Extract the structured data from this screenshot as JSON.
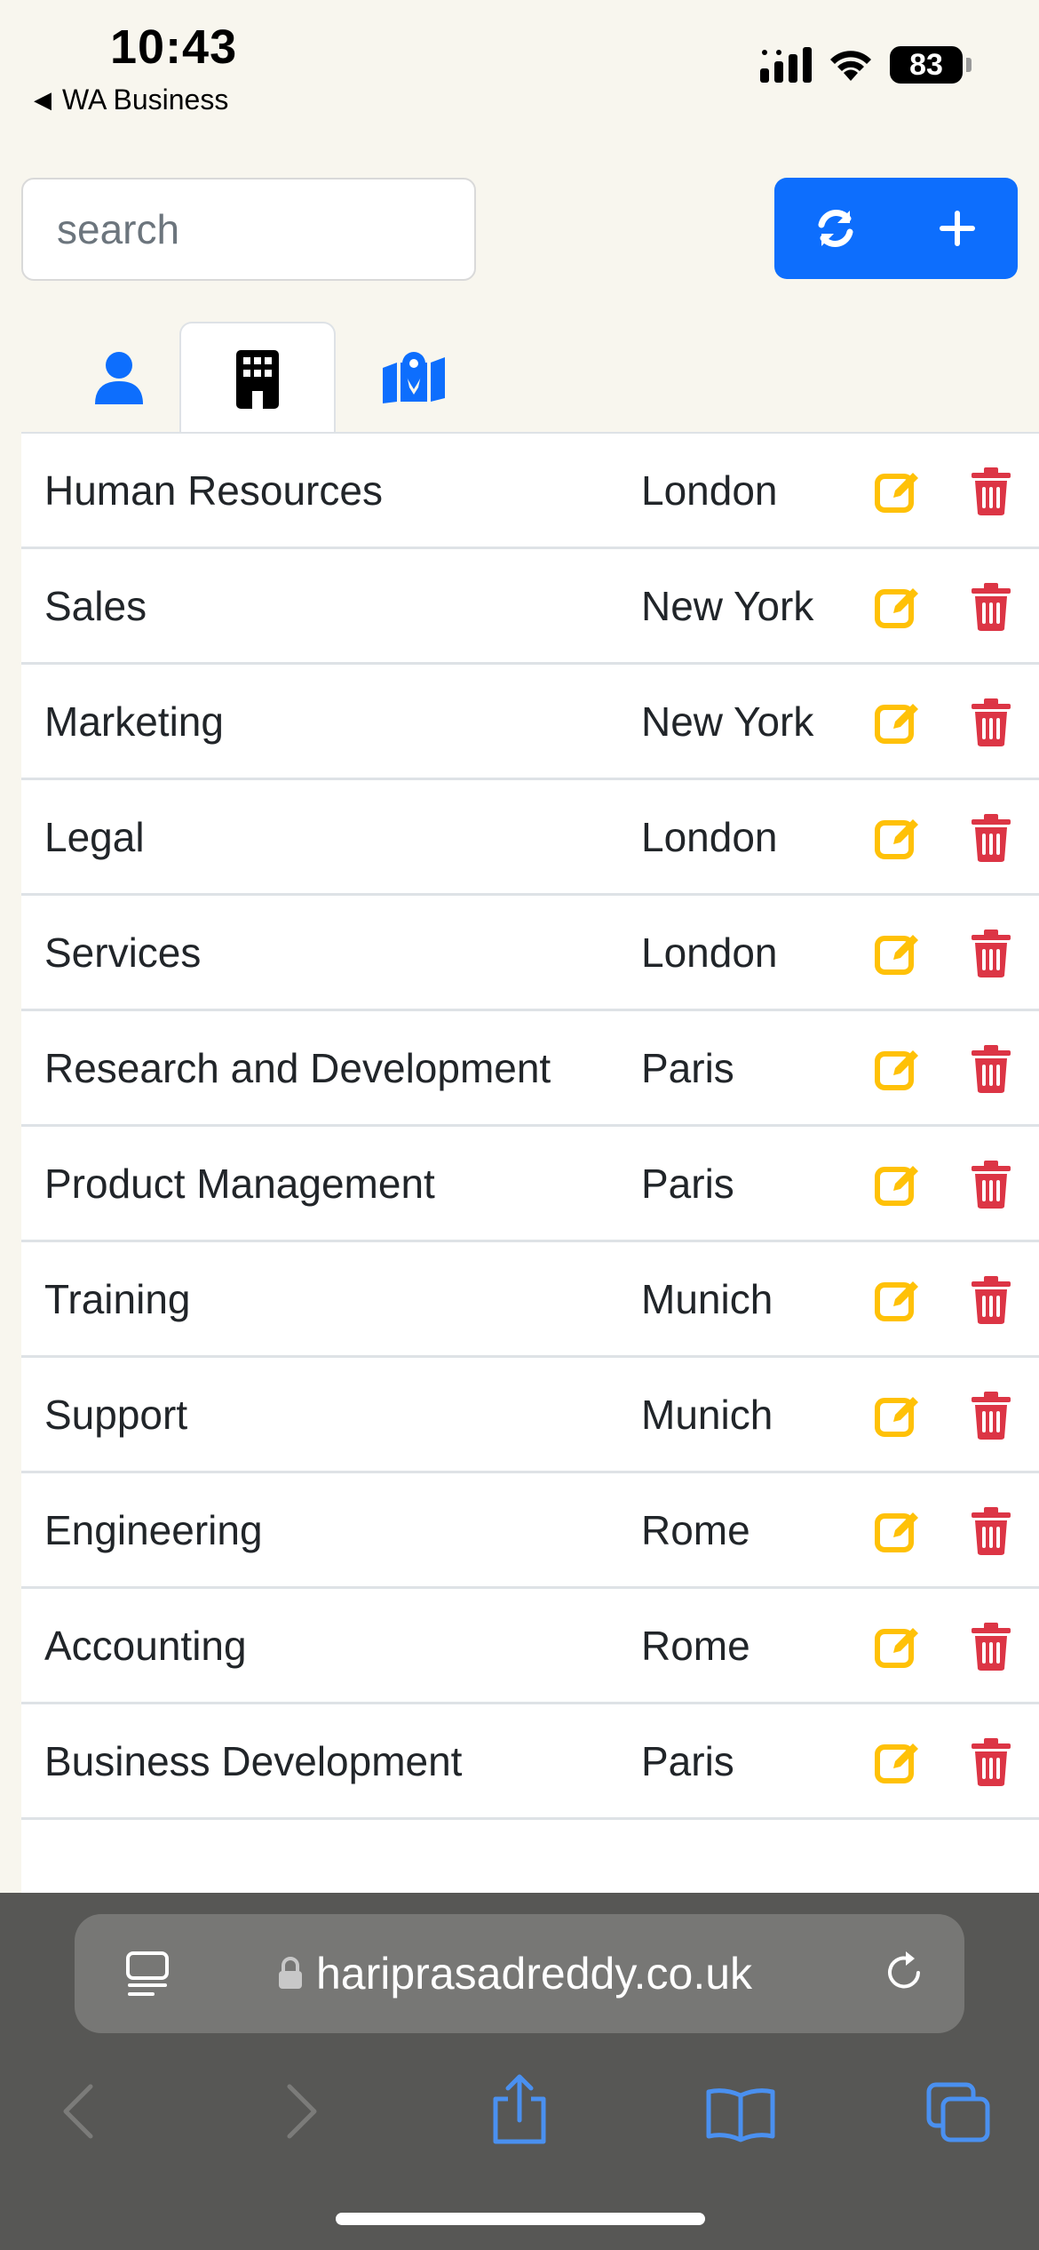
{
  "status_bar": {
    "time": "10:43",
    "back_app_label": "WA Business",
    "battery_level": "83"
  },
  "toolbar": {
    "search_placeholder": "search",
    "refresh_icon": "refresh-icon",
    "add_icon": "plus-icon"
  },
  "tabs": [
    {
      "icon": "user-icon",
      "active": false
    },
    {
      "icon": "building-icon",
      "active": true
    },
    {
      "icon": "map-location-icon",
      "active": false
    }
  ],
  "departments": [
    {
      "name": "Human Resources",
      "location": "London"
    },
    {
      "name": "Sales",
      "location": "New York"
    },
    {
      "name": "Marketing",
      "location": "New York"
    },
    {
      "name": "Legal",
      "location": "London"
    },
    {
      "name": "Services",
      "location": "London"
    },
    {
      "name": "Research and Development",
      "location": "Paris"
    },
    {
      "name": "Product Management",
      "location": "Paris"
    },
    {
      "name": "Training",
      "location": "Munich"
    },
    {
      "name": "Support",
      "location": "Munich"
    },
    {
      "name": "Engineering",
      "location": "Rome"
    },
    {
      "name": "Accounting",
      "location": "Rome"
    },
    {
      "name": "Business Development",
      "location": "Paris"
    }
  ],
  "browser": {
    "url": "hariprasadreddy.co.uk"
  },
  "colors": {
    "primary": "#0d6efd",
    "edit": "#ffc107",
    "delete": "#dc3545",
    "background": "#f8f6ee"
  }
}
